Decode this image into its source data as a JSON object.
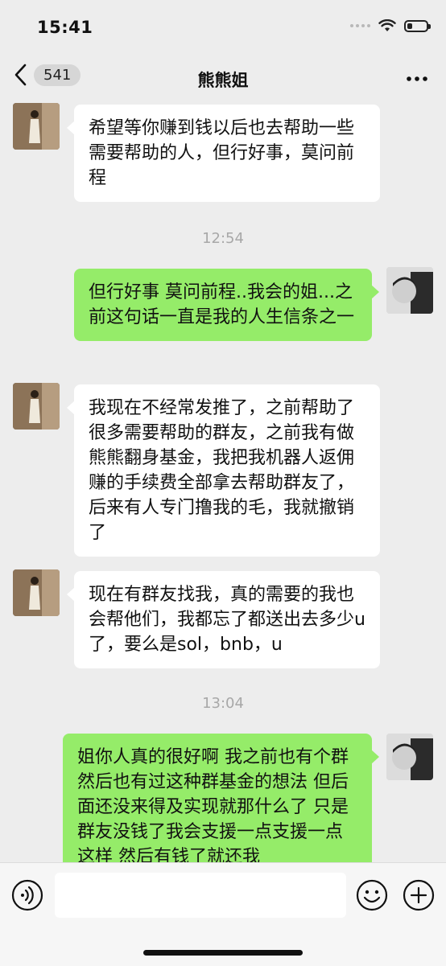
{
  "status_bar": {
    "time": "15:41"
  },
  "nav": {
    "back_count": "541",
    "title": "熊熊姐"
  },
  "messages": [
    {
      "side": "left",
      "text": "希望等你赚到钱以后也去帮助一些需要帮助的人，但行好事，莫问前程"
    },
    {
      "type": "timestamp",
      "text": "12:54"
    },
    {
      "side": "right",
      "text": "但行好事 莫问前程..我会的姐...之前这句话一直是我的人生信条之一"
    },
    {
      "side": "left",
      "text": "我现在不经常发推了，之前帮助了很多需要帮助的群友，之前我有做熊熊翻身基金，我把我机器人返佣赚的手续费全部拿去帮助群友了，后来有人专门撸我的毛，我就撤销了"
    },
    {
      "side": "left",
      "text": "现在有群友找我，真的需要的我也会帮他们，我都忘了都送出去多少u了，要么是sol，bnb，u"
    },
    {
      "type": "timestamp",
      "text": "13:04"
    },
    {
      "side": "right",
      "text": "姐你人真的很好啊 我之前也有个群然后也有过这种群基金的想法 但后面还没来得及实现就那什么了 只是群友没钱了我会支援一点支援一点这样 然后有钱了就还我"
    }
  ],
  "input": {
    "placeholder": ""
  },
  "icons": {
    "back": "chevron-left-icon",
    "more": "more-dots-icon",
    "voice": "voice-icon",
    "emoji": "emoji-icon",
    "plus": "plus-icon"
  },
  "colors": {
    "background": "#ededed",
    "incoming_bubble": "#ffffff",
    "outgoing_bubble": "#95ec69",
    "timestamp": "#a8a8a8"
  }
}
